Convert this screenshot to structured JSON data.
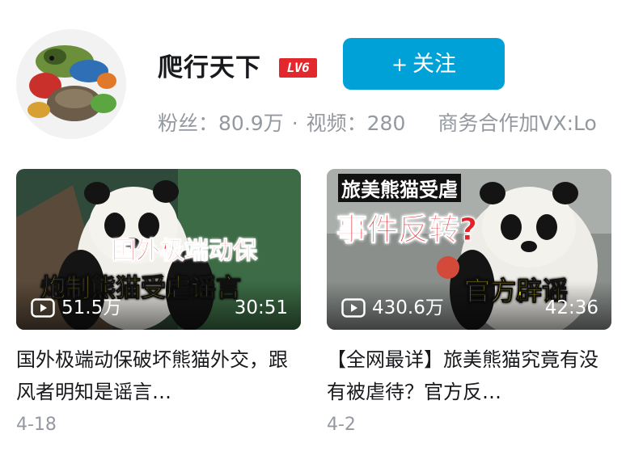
{
  "profile": {
    "username": "爬行天下",
    "level_badge": "LV6",
    "follow_label": "关注",
    "fans_label": "粉丝：",
    "fans_value": "80.9万",
    "separator": "·",
    "videos_label": "视频：",
    "videos_value": "280",
    "business_text": "商务合作加VX:Lo"
  },
  "videos": [
    {
      "thumb_line1": "国外极端动保",
      "thumb_line2": "炮制熊猫受虐谣言",
      "views": "51.5万",
      "duration": "30:51",
      "title": "国外极端动保破坏熊猫外交，跟风者明知是谣言…",
      "date": "4-18"
    },
    {
      "thumb_line1": "旅美熊猫受虐",
      "thumb_line2": "事件反转?",
      "thumb_line3": "官方辟谣",
      "views": "430.6万",
      "duration": "42:36",
      "title": "【全网最详】旅美熊猫究竟有没有被虐待？官方反…",
      "date": "4-2"
    }
  ],
  "colors": {
    "follow_button": "#00a1d6",
    "level_badge": "#e3282d",
    "muted_text": "#9499a0",
    "primary_text": "#18191c"
  }
}
